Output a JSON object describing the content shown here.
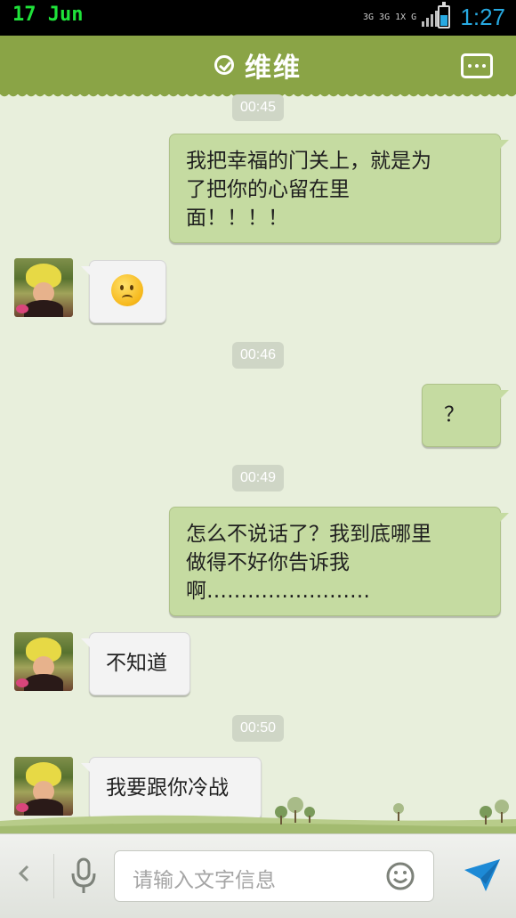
{
  "status_bar": {
    "date": "17 Jun",
    "net_left": "3G",
    "net_mid": "3G 1X",
    "net_right": "G",
    "time": "1:27",
    "battery_level": 0.55
  },
  "header": {
    "title": "维维",
    "check_icon": "check-circle-icon",
    "more_icon": "more-options-icon"
  },
  "messages": [
    {
      "kind": "time",
      "text": "00:45"
    },
    {
      "kind": "sent",
      "lines": [
        "我把幸福的门关上，就是为",
        "了把你的心留在里",
        "面！！！！"
      ]
    },
    {
      "kind": "received",
      "emoji": "frown-emoji-icon"
    },
    {
      "kind": "time",
      "text": "00:46"
    },
    {
      "kind": "sent",
      "lines": [
        "？"
      ]
    },
    {
      "kind": "time",
      "text": "00:49"
    },
    {
      "kind": "sent",
      "lines": [
        "怎么不说话了？我到底哪里",
        "做得不好你告诉我",
        "啊……………………"
      ]
    },
    {
      "kind": "received",
      "lines": [
        "不知道"
      ]
    },
    {
      "kind": "time",
      "text": "00:50"
    },
    {
      "kind": "received",
      "lines": [
        "我要跟你冷战"
      ]
    }
  ],
  "input_bar": {
    "placeholder": "请输入文字信息",
    "back_icon": "chevron-left-icon",
    "mic_icon": "microphone-icon",
    "smile_icon": "smiley-icon",
    "send_icon": "send-icon"
  },
  "colors": {
    "header_bg": "#8aa446",
    "sent_bubble": "#c5dba1",
    "received_bubble": "#f3f3f3",
    "chat_bg": "#e8efdc",
    "status_time": "#27a9e1",
    "status_date": "#1fe33a"
  }
}
